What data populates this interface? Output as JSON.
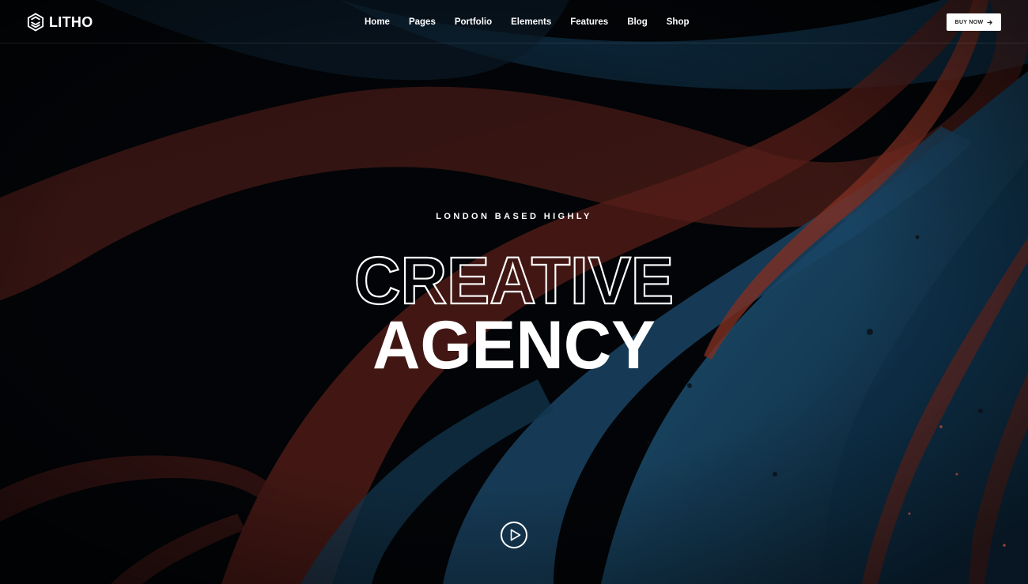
{
  "brand": {
    "name": "LITHO",
    "icon": "hexagon-cube-icon"
  },
  "nav": {
    "items": [
      {
        "label": "Home"
      },
      {
        "label": "Pages"
      },
      {
        "label": "Portfolio"
      },
      {
        "label": "Elements"
      },
      {
        "label": "Features"
      },
      {
        "label": "Blog"
      },
      {
        "label": "Shop"
      }
    ]
  },
  "header": {
    "buy_label": "BUY NOW",
    "buy_icon": "arrow-right-icon"
  },
  "hero": {
    "eyebrow": "LONDON BASED HIGHLY",
    "title_outline": "CREATIVE",
    "title_solid": "AGENCY",
    "play_icon": "play-icon"
  },
  "colors": {
    "background": "#04060a",
    "swirl_blue": "#1f5c84",
    "swirl_red": "#8a2f25",
    "text": "#ffffff"
  }
}
